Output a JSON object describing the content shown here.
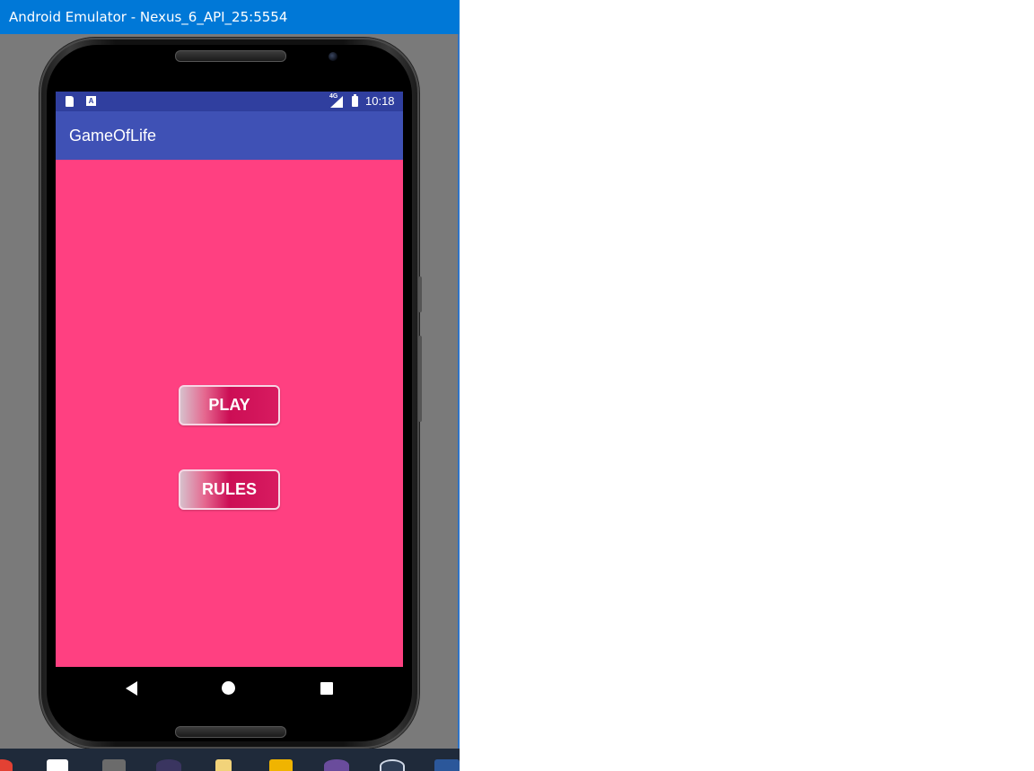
{
  "window": {
    "title": "Android Emulator - Nexus_6_API_25:5554"
  },
  "status_bar": {
    "network": "4G",
    "time": "10:18",
    "icons": [
      "sd-card-icon",
      "keyboard-a-icon",
      "signal-icon",
      "battery-icon"
    ]
  },
  "app": {
    "title": "GameOfLife"
  },
  "buttons": {
    "play": "PLAY",
    "rules": "RULES"
  },
  "navigation": {
    "icons": [
      "back-icon",
      "home-icon",
      "recents-icon"
    ]
  },
  "taskbar": {
    "icons": [
      "chrome-icon",
      "store-icon",
      "sublime-icon",
      "eclipse-icon",
      "file-explorer-icon",
      "search-app-icon",
      "github-icon",
      "app-icon",
      "word-icon"
    ]
  },
  "colors": {
    "status_bar": "#303f9f",
    "app_bar": "#3f51b5",
    "background": "#ff4081",
    "title_bar": "#0078d7"
  }
}
